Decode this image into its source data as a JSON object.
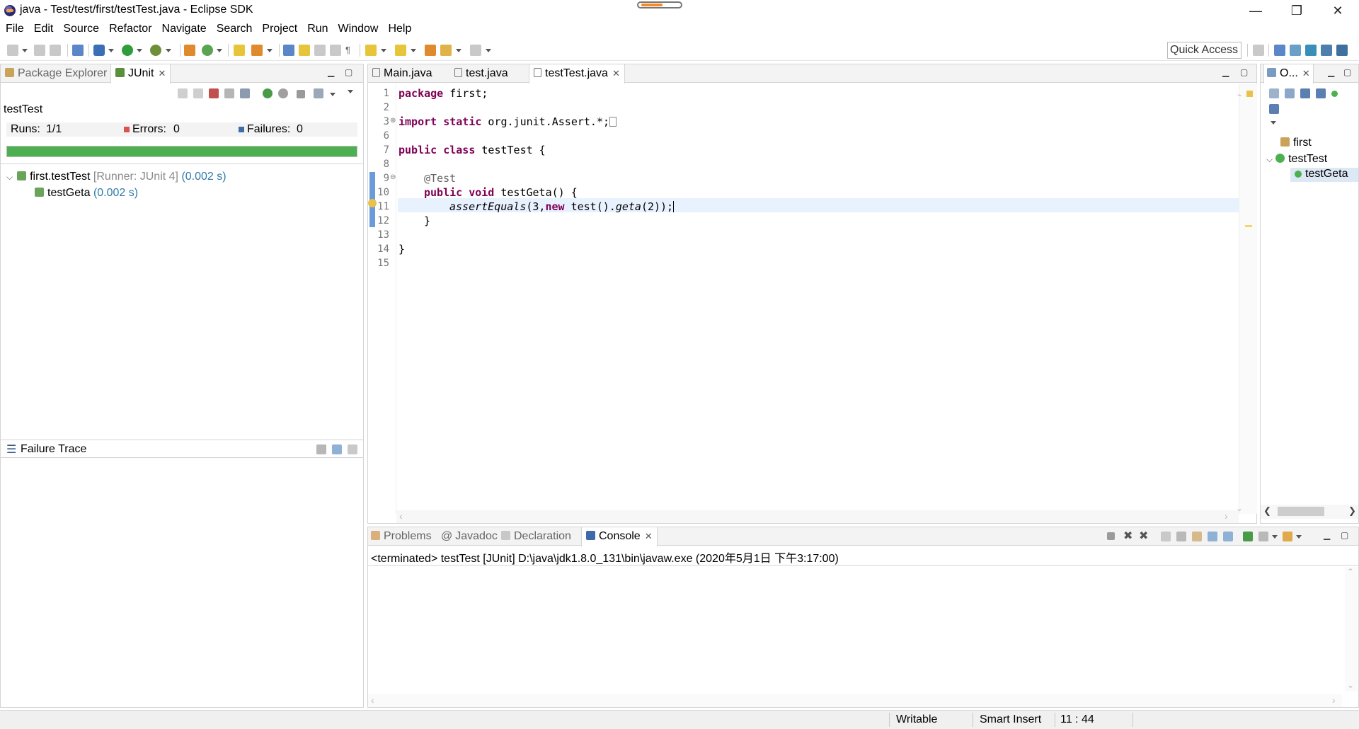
{
  "window": {
    "title": "java - Test/test/first/testTest.java - Eclipse SDK",
    "minimize": "—",
    "restore": "❐",
    "close": "✕"
  },
  "menu": [
    "File",
    "Edit",
    "Source",
    "Refactor",
    "Navigate",
    "Search",
    "Project",
    "Run",
    "Window",
    "Help"
  ],
  "toolbar": {
    "quick_access": "Quick Access"
  },
  "left_panel": {
    "tabs": [
      {
        "label": "Package Explorer",
        "active": false
      },
      {
        "label": "JUnit",
        "active": true
      }
    ],
    "test_name": "testTest",
    "runs_label": "Runs:",
    "runs_value": "1/1",
    "errors_label": "Errors:",
    "errors_value": "0",
    "failures_label": "Failures:",
    "failures_value": "0",
    "progress_color": "#4caf50",
    "progress_fraction": 1.0,
    "tree": {
      "root_name": "first.testTest",
      "root_runner": "[Runner: JUnit 4]",
      "root_time": "(0.002 s)",
      "child_name": "testGeta",
      "child_time": "(0.002 s)"
    },
    "failure_trace_label": "Failure Trace"
  },
  "editor": {
    "tabs": [
      {
        "label": "Main.java",
        "active": false
      },
      {
        "label": "test.java",
        "active": false
      },
      {
        "label": "testTest.java",
        "active": true
      }
    ],
    "line_numbers": [
      "1",
      "2",
      "3",
      "6",
      "7",
      "8",
      "9",
      "10",
      "11",
      "12",
      "13",
      "14",
      "15"
    ],
    "lines": {
      "l1_kw": "package",
      "l1_rest": " first;",
      "l3_kw1": "import",
      "l3_kw2": " static",
      "l3_rest": " org.junit.Assert.*;",
      "l7_kw1": "public",
      "l7_kw2": " class",
      "l7_rest": " testTest {",
      "l9_ann": "@Test",
      "l10_kw1": "public",
      "l10_kw2": " void",
      "l10_rest": " testGeta() {",
      "l11_method": "assertEquals",
      "l11_a": "(3,",
      "l11_kw": "new",
      "l11_b": " test().",
      "l11_c": "geta",
      "l11_d": "(2));",
      "l12": "}",
      "l14": "}"
    },
    "cursor_position": "11 : 44"
  },
  "outline_panel": {
    "tab_label": "O...",
    "items": [
      {
        "label": "first"
      },
      {
        "label": "testTest"
      },
      {
        "label": "testGeta"
      }
    ]
  },
  "bottom_panel": {
    "tabs": [
      {
        "label": "Problems",
        "active": false
      },
      {
        "label": "Javadoc",
        "active": false
      },
      {
        "label": "Declaration",
        "active": false
      },
      {
        "label": "Console",
        "active": true
      }
    ],
    "console_header": "<terminated> testTest [JUnit] D:\\java\\jdk1.8.0_131\\bin\\javaw.exe (2020年5月1日 下午3:17:00)"
  },
  "status_bar": {
    "writable": "Writable",
    "insert_mode": "Smart Insert",
    "position": "11 : 44"
  }
}
